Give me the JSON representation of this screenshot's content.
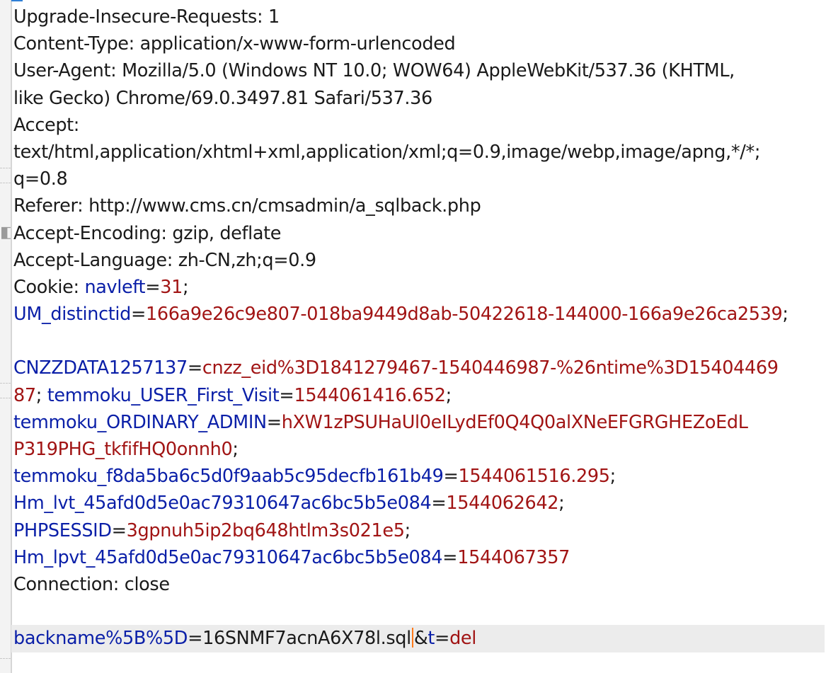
{
  "request": {
    "headers": {
      "upgrade": "Upgrade-Insecure-Requests: 1",
      "content_type": "Content-Type: application/x-www-form-urlencoded",
      "ua_line1": "User-Agent: Mozilla/5.0 (Windows NT 10.0; WOW64) AppleWebKit/537.36 (KHTML,",
      "ua_line2": "like Gecko) Chrome/69.0.3497.81 Safari/537.36",
      "accept_label": "Accept:",
      "accept_line1": "text/html,application/xhtml+xml,application/xml;q=0.9,image/webp,image/apng,*/*;",
      "accept_line2": "q=0.8",
      "referer": "Referer: http://www.cms.cn/cmsadmin/a_sqlback.php",
      "accept_encoding": "Accept-Encoding: gzip, deflate",
      "accept_language": "Accept-Language: zh-CN,zh;q=0.9",
      "cookie_label": "Cookie: ",
      "connection": "Connection: close"
    },
    "cookies": [
      {
        "name": "navleft",
        "value": "31",
        "sep": ";"
      },
      {
        "name": "UM_distinctid",
        "value": "166a9e26c9e807-018ba9449d8ab-50422618-144000-166a9e26ca2539",
        "sep": ";"
      },
      {
        "name": "CNZZDATA1257137",
        "value_line1": "cnzz_eid%3D1841279467-1540446987-%26ntime%3D15404469",
        "value_line2": "87",
        "sep": ";"
      },
      {
        "name": "temmoku_USER_First_Visit",
        "value": "1544061416.652",
        "sep": ";"
      },
      {
        "name": "temmoku_ORDINARY_ADMIN",
        "value_line1": "hXW1zPSUHaUl0eILydEf0Q4Q0alXNeEFGRGHEZoEdL",
        "value_line2": "P319PHG_tkfifHQ0onnh0",
        "sep": ";"
      },
      {
        "name": "temmoku_f8da5ba6c5d0f9aab5c95decfb161b49",
        "value": "1544061516.295",
        "sep": ";"
      },
      {
        "name": "Hm_lvt_45afd0d5e0ac79310647ac6bc5b5e084",
        "value": "1544062642",
        "sep": ";"
      },
      {
        "name": "PHPSESSID",
        "value": "3gpnuh5ip2bq648htlm3s021e5",
        "sep": ";"
      },
      {
        "name": "Hm_lpvt_45afd0d5e0ac79310647ac6bc5b5e084",
        "value": "1544067357",
        "sep": ""
      }
    ],
    "body": {
      "param1_name": "backname%5B%5D",
      "param1_value": "16SNMF7acnA6X78l.sql",
      "amp": "&",
      "param2_name": "t",
      "param2_value": "del"
    },
    "eq": "=",
    "space": " "
  },
  "colors": {
    "key": "#0a1fa8",
    "value": "#a11414",
    "text": "#1a1a1a",
    "caret": "#ff7a1a"
  }
}
